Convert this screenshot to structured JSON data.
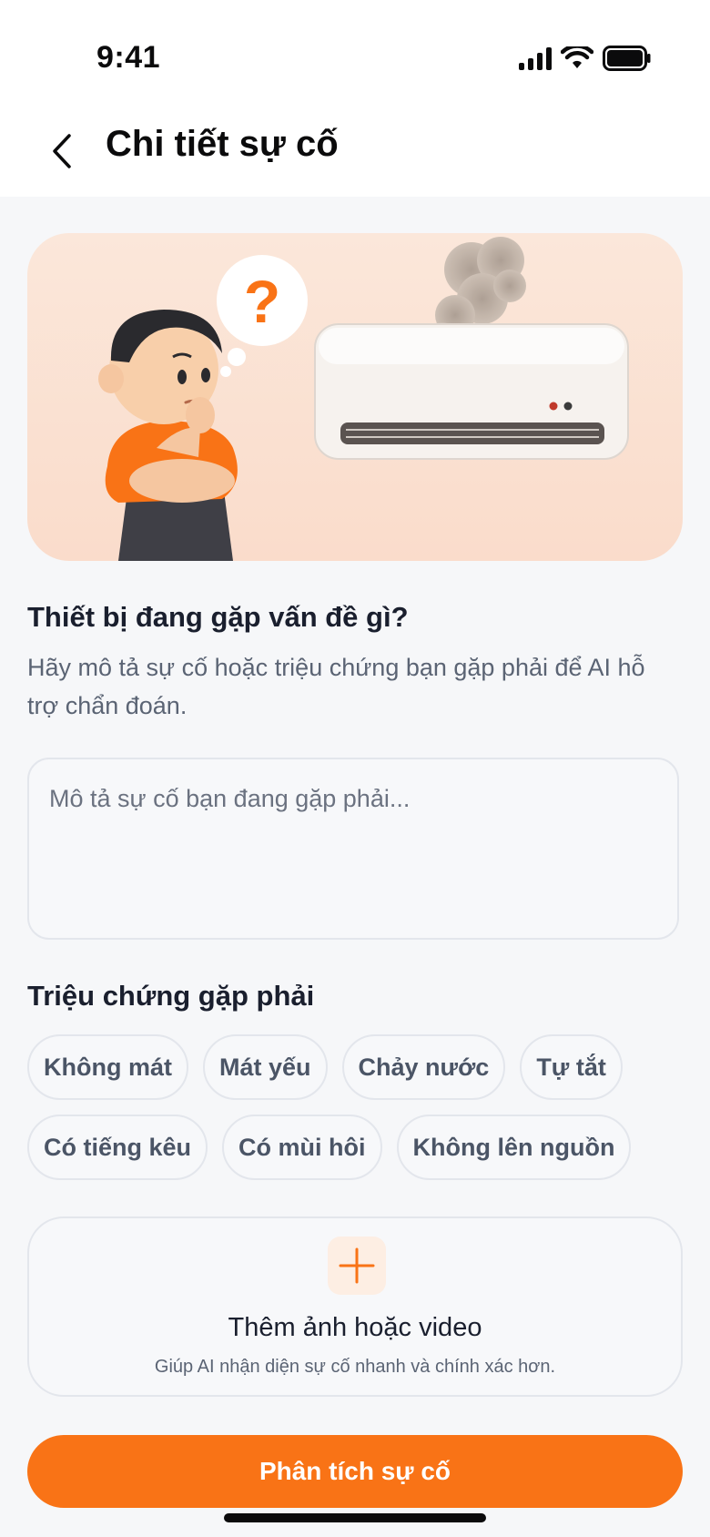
{
  "status_bar": {
    "time": "9:41"
  },
  "header": {
    "title": "Chi tiết sự cố"
  },
  "problem": {
    "title": "Thiết bị đang gặp vấn đề gì?",
    "description": "Hãy mô tả sự cố hoặc triệu chứng bạn gặp phải để AI hỗ trợ chẩn đoán.",
    "input_value": "",
    "input_placeholder": "Mô tả sự cố bạn đang gặp phải..."
  },
  "symptoms": {
    "title": "Triệu chứng gặp phải",
    "chips": [
      "Không mát",
      "Mát yếu",
      "Chảy nước",
      "Tự tắt",
      "Có tiếng kêu",
      "Có mùi hôi",
      "Không lên nguồn"
    ]
  },
  "upload": {
    "title": "Thêm ảnh hoặc video",
    "subtitle": "Giúp AI nhận diện sự cố nhanh và chính xác hơn."
  },
  "cta": {
    "label": "Phân tích sự cố"
  },
  "colors": {
    "accent": "#f97316",
    "background": "#f6f7f9",
    "chip_text": "#4b5566",
    "hero_bg": "#fbe7da"
  },
  "icons": {
    "back": "chevron-left-icon",
    "signal": "cellular-signal-icon",
    "wifi": "wifi-icon",
    "battery": "battery-icon",
    "plus": "plus-icon"
  }
}
